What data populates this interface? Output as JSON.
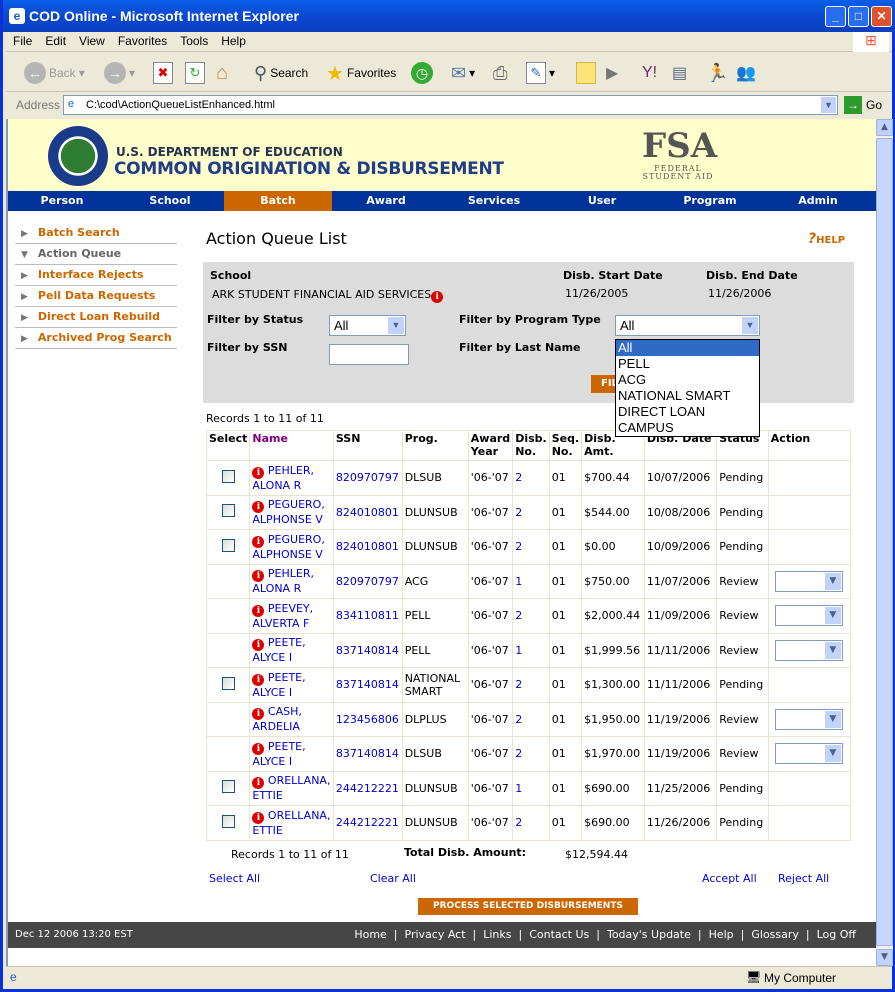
{
  "window": {
    "title": "COD Online - Microsoft Internet Explorer"
  },
  "menu": [
    "File",
    "Edit",
    "View",
    "Favorites",
    "Tools",
    "Help"
  ],
  "toolbar": {
    "back": "Back",
    "search": "Search",
    "favorites": "Favorites"
  },
  "address": {
    "label": "Address",
    "url": "C:\\cod\\ActionQueueListEnhanced.html",
    "go": "Go"
  },
  "banner": {
    "dept": "U.S. DEPARTMENT OF EDUCATION",
    "title": "COMMON ORIGINATION & DISBURSEMENT",
    "fsa": "FSA",
    "fsa_sub1": "FEDERAL",
    "fsa_sub2": "STUDENT AID"
  },
  "nav": [
    "Person",
    "School",
    "Batch",
    "Award",
    "Services",
    "User",
    "Program",
    "Admin"
  ],
  "sidebar": [
    "Batch Search",
    "Action Queue",
    "Interface Rejects",
    "Pell Data Requests",
    "Direct Loan Rebuild",
    "Archived Prog Search"
  ],
  "page": {
    "title": "Action Queue List",
    "help": "HELP"
  },
  "filter": {
    "school_label": "School",
    "school": "ARK STUDENT FINANCIAL AID SERVICES",
    "start_label": "Disb. Start Date",
    "start": "11/26/2005",
    "end_label": "Disb. End Date",
    "end": "11/26/2006",
    "status_label": "Filter by Status",
    "status_value": "All",
    "ssn_label": "Filter by SSN",
    "program_label": "Filter by Program Type",
    "program_value": "All",
    "lastname_label": "Filter by Last Name",
    "button": "FILTER",
    "program_options": [
      "All",
      "PELL",
      "ACG",
      "NATIONAL SMART",
      "DIRECT LOAN",
      "CAMPUS"
    ]
  },
  "records": "Records 1 to 11 of 11",
  "table": {
    "headers": [
      "Select",
      "Name",
      "SSN",
      "Prog.",
      "Award Year",
      "Disb. No.",
      "Seq. No.",
      "Disb. Amt.",
      "Disb. Date",
      "Status",
      "Action"
    ],
    "rows": [
      {
        "check": true,
        "name": "PEHLER, ALONA R",
        "ssn": "820970797",
        "prog": "DLSUB",
        "year": "'06-'07",
        "disb": "2",
        "seq": "01",
        "amt": "$700.44",
        "date": "10/07/2006",
        "status": "Pending"
      },
      {
        "check": true,
        "name": "PEGUERO, ALPHONSE V",
        "ssn": "824010801",
        "prog": "DLUNSUB",
        "year": "'06-'07",
        "disb": "2",
        "seq": "01",
        "amt": "$544.00",
        "date": "10/08/2006",
        "status": "Pending"
      },
      {
        "check": true,
        "name": "PEGUERO, ALPHONSE V",
        "ssn": "824010801",
        "prog": "DLUNSUB",
        "year": "'06-'07",
        "disb": "2",
        "seq": "01",
        "amt": "$0.00",
        "date": "10/09/2006",
        "status": "Pending"
      },
      {
        "check": false,
        "name": "PEHLER, ALONA R",
        "ssn": "820970797",
        "prog": "ACG",
        "year": "'06-'07",
        "disb": "1",
        "seq": "01",
        "amt": "$750.00",
        "date": "11/07/2006",
        "status": "Review"
      },
      {
        "check": false,
        "name": "PEEVEY, ALVERTA F",
        "ssn": "834110811",
        "prog": "PELL",
        "year": "'06-'07",
        "disb": "2",
        "seq": "01",
        "amt": "$2,000.44",
        "date": "11/09/2006",
        "status": "Review"
      },
      {
        "check": false,
        "name": "PEETE, ALYCE I",
        "ssn": "837140814",
        "prog": "PELL",
        "year": "'06-'07",
        "disb": "1",
        "seq": "01",
        "amt": "$1,999.56",
        "date": "11/11/2006",
        "status": "Review"
      },
      {
        "check": true,
        "name": "PEETE, ALYCE I",
        "ssn": "837140814",
        "prog": "NATIONAL SMART",
        "year": "'06-'07",
        "disb": "2",
        "seq": "01",
        "amt": "$1,300.00",
        "date": "11/11/2006",
        "status": "Pending"
      },
      {
        "check": false,
        "name": "CASH, ARDELIA",
        "ssn": "123456806",
        "prog": "DLPLUS",
        "year": "'06-'07",
        "disb": "2",
        "seq": "01",
        "amt": "$1,950.00",
        "date": "11/19/2006",
        "status": "Review"
      },
      {
        "check": false,
        "name": "PEETE, ALYCE I",
        "ssn": "837140814",
        "prog": "DLSUB",
        "year": "'06-'07",
        "disb": "2",
        "seq": "01",
        "amt": "$1,970.00",
        "date": "11/19/2006",
        "status": "Review"
      },
      {
        "check": true,
        "name": "ORELLANA, ETTIE",
        "ssn": "244212221",
        "prog": "DLUNSUB",
        "year": "'06-'07",
        "disb": "1",
        "seq": "01",
        "amt": "$690.00",
        "date": "11/25/2006",
        "status": "Pending"
      },
      {
        "check": true,
        "name": "ORELLANA, ETTIE",
        "ssn": "244212221",
        "prog": "DLUNSUB",
        "year": "'06-'07",
        "disb": "2",
        "seq": "01",
        "amt": "$690.00",
        "date": "11/26/2006",
        "status": "Pending"
      }
    ]
  },
  "summary": {
    "records": "Records 1 to 11 of 11",
    "total_label": "Total Disb. Amount:",
    "total": "$12,594.44"
  },
  "links": {
    "select_all": "Select All",
    "clear_all": "Clear All",
    "accept_all": "Accept All",
    "reject_all": "Reject All"
  },
  "process_button": "PROCESS SELECTED DISBURSEMENTS",
  "footer": {
    "timestamp": "Dec 12 2006 13:20 EST",
    "links": [
      "Home",
      "Privacy Act",
      "Links",
      "Contact Us",
      "Today's Update",
      "Help",
      "Glossary",
      "Log Off"
    ]
  },
  "status": {
    "zone": "My Computer"
  }
}
